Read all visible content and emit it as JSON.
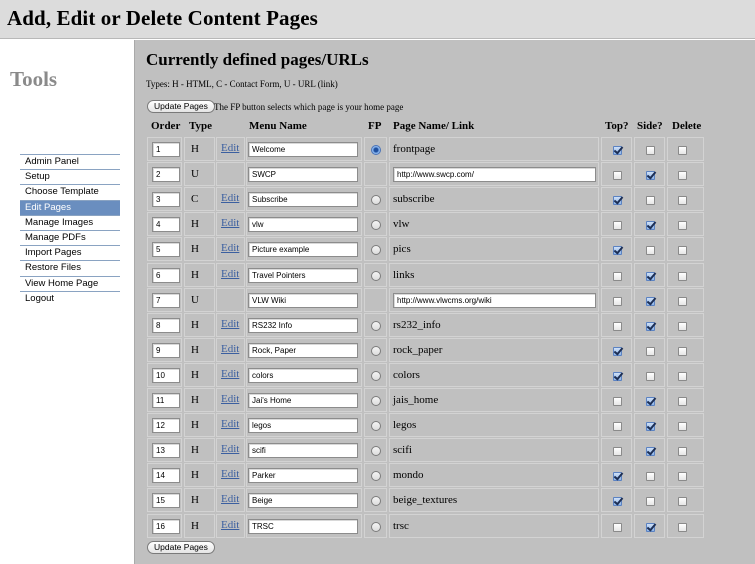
{
  "header": {
    "title": "Add, Edit or Delete Content Pages"
  },
  "sidebar": {
    "title": "Tools",
    "items": [
      {
        "label": "Admin Panel",
        "active": false
      },
      {
        "label": "Setup",
        "active": false
      },
      {
        "label": "Choose Template",
        "active": false
      },
      {
        "label": "Edit Pages",
        "active": true
      },
      {
        "label": "Manage Images",
        "active": false
      },
      {
        "label": "Manage PDFs",
        "active": false
      },
      {
        "label": "Import Pages",
        "active": false
      },
      {
        "label": "Restore Files",
        "active": false
      },
      {
        "label": "View Home Page",
        "active": false
      },
      {
        "label": "Logout",
        "active": false
      }
    ]
  },
  "main": {
    "title": "Currently defined pages/URLs",
    "types_legend": "Types: H - HTML, C - Contact Form, U - URL (link)",
    "update_button": "Update Pages",
    "fp_note": "The FP button selects which page is your home page",
    "columns": {
      "order": "Order",
      "type": "Type",
      "menu_name": "Menu Name",
      "fp": "FP",
      "page_name": "Page Name/ Link",
      "top": "Top?",
      "side": "Side?",
      "delete": "Delete"
    },
    "edit_label": "Edit",
    "rows": [
      {
        "order": "1",
        "type": "H",
        "edit": true,
        "menu_name": "Welcome",
        "fp": "selected",
        "page": "frontpage",
        "url": false,
        "top": true,
        "side": false,
        "del": false
      },
      {
        "order": "2",
        "type": "U",
        "edit": false,
        "menu_name": "SWCP",
        "fp": "none",
        "page": "http://www.swcp.com/",
        "url": true,
        "top": false,
        "side": true,
        "del": false
      },
      {
        "order": "3",
        "type": "C",
        "edit": true,
        "menu_name": "Subscribe",
        "fp": "unselected",
        "page": "subscribe",
        "url": false,
        "top": true,
        "side": false,
        "del": false
      },
      {
        "order": "4",
        "type": "H",
        "edit": true,
        "menu_name": "vlw",
        "fp": "unselected",
        "page": "vlw",
        "url": false,
        "top": false,
        "side": true,
        "del": false
      },
      {
        "order": "5",
        "type": "H",
        "edit": true,
        "menu_name": "Picture example",
        "fp": "unselected",
        "page": "pics",
        "url": false,
        "top": true,
        "side": false,
        "del": false
      },
      {
        "order": "6",
        "type": "H",
        "edit": true,
        "menu_name": "Travel Pointers",
        "fp": "unselected",
        "page": "links",
        "url": false,
        "top": false,
        "side": true,
        "del": false
      },
      {
        "order": "7",
        "type": "U",
        "edit": false,
        "menu_name": "VLW Wiki",
        "fp": "none",
        "page": "http://www.vlwcms.org/wiki",
        "url": true,
        "top": false,
        "side": true,
        "del": false
      },
      {
        "order": "8",
        "type": "H",
        "edit": true,
        "menu_name": "RS232 Info",
        "fp": "unselected",
        "page": "rs232_info",
        "url": false,
        "top": false,
        "side": true,
        "del": false
      },
      {
        "order": "9",
        "type": "H",
        "edit": true,
        "menu_name": "Rock, Paper",
        "fp": "unselected",
        "page": "rock_paper",
        "url": false,
        "top": true,
        "side": false,
        "del": false
      },
      {
        "order": "10",
        "type": "H",
        "edit": true,
        "menu_name": "colors",
        "fp": "unselected",
        "page": "colors",
        "url": false,
        "top": true,
        "side": false,
        "del": false
      },
      {
        "order": "11",
        "type": "H",
        "edit": true,
        "menu_name": "Jai's Home",
        "fp": "unselected",
        "page": "jais_home",
        "url": false,
        "top": false,
        "side": true,
        "del": false
      },
      {
        "order": "12",
        "type": "H",
        "edit": true,
        "menu_name": "legos",
        "fp": "unselected",
        "page": "legos",
        "url": false,
        "top": false,
        "side": true,
        "del": false
      },
      {
        "order": "13",
        "type": "H",
        "edit": true,
        "menu_name": "scifi",
        "fp": "unselected",
        "page": "scifi",
        "url": false,
        "top": false,
        "side": true,
        "del": false
      },
      {
        "order": "14",
        "type": "H",
        "edit": true,
        "menu_name": "Parker",
        "fp": "unselected",
        "page": "mondo",
        "url": false,
        "top": true,
        "side": false,
        "del": false
      },
      {
        "order": "15",
        "type": "H",
        "edit": true,
        "menu_name": "Beige",
        "fp": "unselected",
        "page": "beige_textures",
        "url": false,
        "top": true,
        "side": false,
        "del": false
      },
      {
        "order": "16",
        "type": "H",
        "edit": true,
        "menu_name": "TRSC",
        "fp": "unselected",
        "page": "trsc",
        "url": false,
        "top": false,
        "side": true,
        "del": false
      }
    ]
  }
}
